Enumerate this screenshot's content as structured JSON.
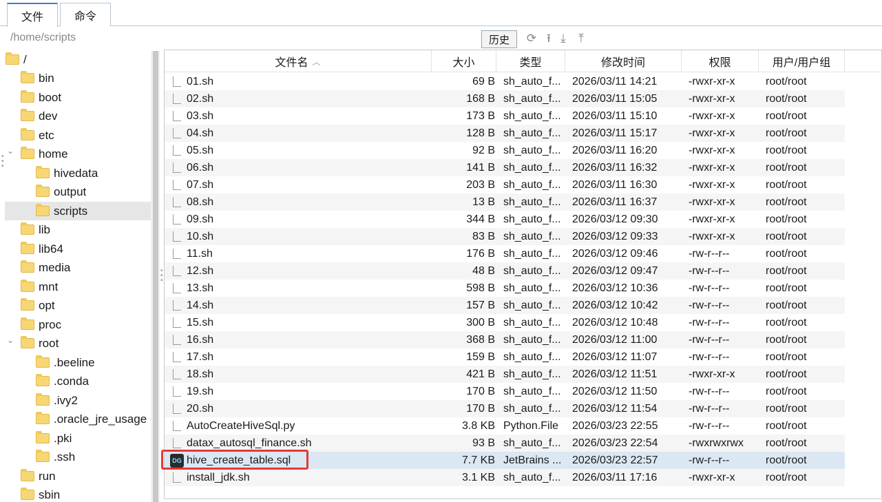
{
  "tabs": [
    {
      "label": "文件"
    },
    {
      "label": "命令"
    }
  ],
  "path": "/home/scripts",
  "history_label": "历史",
  "toolbar_icons": [
    "refresh-icon",
    "upload-arrow-icon",
    "download-icon",
    "upload-icon"
  ],
  "tree": {
    "root": "/",
    "items": [
      {
        "label": "bin"
      },
      {
        "label": "boot"
      },
      {
        "label": "dev"
      },
      {
        "label": "etc"
      },
      {
        "label": "home"
      },
      {
        "label": "hivedata"
      },
      {
        "label": "output"
      },
      {
        "label": "scripts"
      },
      {
        "label": "lib"
      },
      {
        "label": "lib64"
      },
      {
        "label": "media"
      },
      {
        "label": "mnt"
      },
      {
        "label": "opt"
      },
      {
        "label": "proc"
      },
      {
        "label": "root"
      },
      {
        "label": ".beeline"
      },
      {
        "label": ".conda"
      },
      {
        "label": ".ivy2"
      },
      {
        "label": ".oracle_jre_usage"
      },
      {
        "label": ".pki"
      },
      {
        "label": ".ssh"
      },
      {
        "label": "run"
      },
      {
        "label": "sbin"
      }
    ]
  },
  "columns": {
    "name": "文件名",
    "size": "大小",
    "type": "类型",
    "modified": "修改时间",
    "perm": "权限",
    "user": "用户/用户组"
  },
  "files": [
    {
      "name": "01.sh",
      "size": "69 B",
      "type": "sh_auto_f...",
      "time": "2026/03/11 14:21",
      "perm": "-rwxr-xr-x",
      "user": "root/root"
    },
    {
      "name": "02.sh",
      "size": "168 B",
      "type": "sh_auto_f...",
      "time": "2026/03/11 15:05",
      "perm": "-rwxr-xr-x",
      "user": "root/root"
    },
    {
      "name": "03.sh",
      "size": "173 B",
      "type": "sh_auto_f...",
      "time": "2026/03/11 15:10",
      "perm": "-rwxr-xr-x",
      "user": "root/root"
    },
    {
      "name": "04.sh",
      "size": "128 B",
      "type": "sh_auto_f...",
      "time": "2026/03/11 15:17",
      "perm": "-rwxr-xr-x",
      "user": "root/root"
    },
    {
      "name": "05.sh",
      "size": "92 B",
      "type": "sh_auto_f...",
      "time": "2026/03/11 16:20",
      "perm": "-rwxr-xr-x",
      "user": "root/root"
    },
    {
      "name": "06.sh",
      "size": "141 B",
      "type": "sh_auto_f...",
      "time": "2026/03/11 16:32",
      "perm": "-rwxr-xr-x",
      "user": "root/root"
    },
    {
      "name": "07.sh",
      "size": "203 B",
      "type": "sh_auto_f...",
      "time": "2026/03/11 16:30",
      "perm": "-rwxr-xr-x",
      "user": "root/root"
    },
    {
      "name": "08.sh",
      "size": "13 B",
      "type": "sh_auto_f...",
      "time": "2026/03/11 16:37",
      "perm": "-rwxr-xr-x",
      "user": "root/root"
    },
    {
      "name": "09.sh",
      "size": "344 B",
      "type": "sh_auto_f...",
      "time": "2026/03/12 09:30",
      "perm": "-rwxr-xr-x",
      "user": "root/root"
    },
    {
      "name": "10.sh",
      "size": "83 B",
      "type": "sh_auto_f...",
      "time": "2026/03/12 09:33",
      "perm": "-rwxr-xr-x",
      "user": "root/root"
    },
    {
      "name": "11.sh",
      "size": "176 B",
      "type": "sh_auto_f...",
      "time": "2026/03/12 09:46",
      "perm": "-rw-r--r--",
      "user": "root/root"
    },
    {
      "name": "12.sh",
      "size": "48 B",
      "type": "sh_auto_f...",
      "time": "2026/03/12 09:47",
      "perm": "-rw-r--r--",
      "user": "root/root"
    },
    {
      "name": "13.sh",
      "size": "598 B",
      "type": "sh_auto_f...",
      "time": "2026/03/12 10:36",
      "perm": "-rw-r--r--",
      "user": "root/root"
    },
    {
      "name": "14.sh",
      "size": "157 B",
      "type": "sh_auto_f...",
      "time": "2026/03/12 10:42",
      "perm": "-rw-r--r--",
      "user": "root/root"
    },
    {
      "name": "15.sh",
      "size": "300 B",
      "type": "sh_auto_f...",
      "time": "2026/03/12 10:48",
      "perm": "-rw-r--r--",
      "user": "root/root"
    },
    {
      "name": "16.sh",
      "size": "368 B",
      "type": "sh_auto_f...",
      "time": "2026/03/12 11:00",
      "perm": "-rw-r--r--",
      "user": "root/root"
    },
    {
      "name": "17.sh",
      "size": "159 B",
      "type": "sh_auto_f...",
      "time": "2026/03/12 11:07",
      "perm": "-rw-r--r--",
      "user": "root/root"
    },
    {
      "name": "18.sh",
      "size": "421 B",
      "type": "sh_auto_f...",
      "time": "2026/03/12 11:51",
      "perm": "-rwxr-xr-x",
      "user": "root/root"
    },
    {
      "name": "19.sh",
      "size": "170 B",
      "type": "sh_auto_f...",
      "time": "2026/03/12 11:50",
      "perm": "-rw-r--r--",
      "user": "root/root"
    },
    {
      "name": "20.sh",
      "size": "170 B",
      "type": "sh_auto_f...",
      "time": "2026/03/12 11:54",
      "perm": "-rw-r--r--",
      "user": "root/root"
    },
    {
      "name": "AutoCreateHiveSql.py",
      "size": "3.8 KB",
      "type": "Python.File",
      "time": "2026/03/23 22:55",
      "perm": "-rw-r--r--",
      "user": "root/root"
    },
    {
      "name": "datax_autosql_finance.sh",
      "size": "93 B",
      "type": "sh_auto_f...",
      "time": "2026/03/23 22:54",
      "perm": "-rwxrwxrwx",
      "user": "root/root"
    },
    {
      "name": "hive_create_table.sql",
      "size": "7.7 KB",
      "type": "JetBrains ...",
      "time": "2026/03/23 22:57",
      "perm": "-rw-r--r--",
      "user": "root/root"
    },
    {
      "name": "install_jdk.sh",
      "size": "3.1 KB",
      "type": "sh_auto_f...",
      "time": "2026/03/11 17:16",
      "perm": "-rwxr-xr-x",
      "user": "root/root"
    }
  ],
  "selected_file_icon_text": "DG",
  "accent_color": "#3a7bd5",
  "highlight_color": "#e53935"
}
